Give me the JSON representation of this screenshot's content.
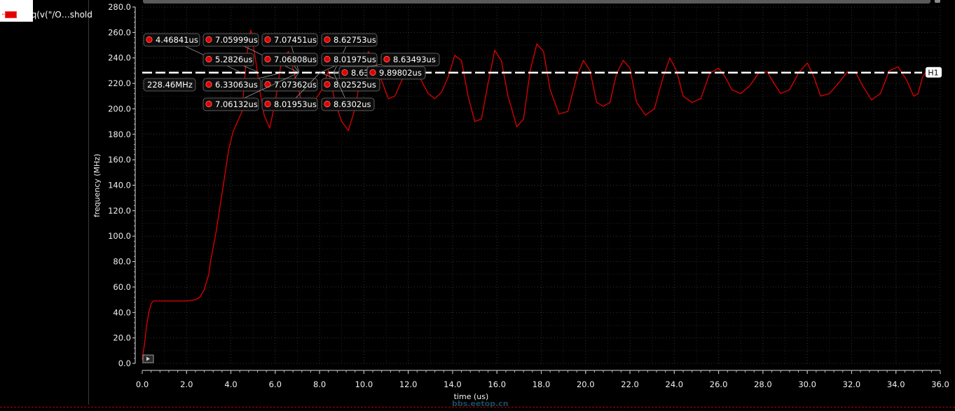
{
  "legend": {
    "label": "freq(v(\"/O…shold"
  },
  "watermark": "bbs.eetop.cn",
  "colors": {
    "trace": "#e00000",
    "background": "#000000",
    "grid": "#2e2e2e",
    "marker_line": "#ffffff"
  },
  "icons": {
    "play": "play-icon"
  },
  "chart_data": {
    "type": "line",
    "xlabel": "time (us)",
    "ylabel": "frequency (MHz)",
    "xlim": [
      0,
      36
    ],
    "ylim": [
      0,
      280
    ],
    "x_ticks": [
      "0.0",
      "2.0",
      "4.0",
      "6.0",
      "8.0",
      "10.0",
      "12.0",
      "14.0",
      "16.0",
      "18.0",
      "20.0",
      "22.0",
      "24.0",
      "26.0",
      "28.0",
      "30.0",
      "32.0",
      "34.0",
      "36.0"
    ],
    "y_ticks": [
      "0.0",
      "20.0",
      "40.0",
      "60.0",
      "80.0",
      "100.0",
      "120.0",
      "140.0",
      "160.0",
      "180.0",
      "200.0",
      "220.0",
      "240.0",
      "260.0",
      "280.0"
    ],
    "grid": true,
    "legend_position": "top-left",
    "series": [
      {
        "name": "freq(v(\"/O…shold",
        "points": [
          [
            0.0,
            3
          ],
          [
            0.1,
            15
          ],
          [
            0.2,
            30
          ],
          [
            0.3,
            40
          ],
          [
            0.4,
            47
          ],
          [
            0.5,
            49
          ],
          [
            0.8,
            49
          ],
          [
            1.5,
            49
          ],
          [
            2.0,
            49
          ],
          [
            2.4,
            50
          ],
          [
            2.6,
            52
          ],
          [
            2.8,
            58
          ],
          [
            3.0,
            70
          ],
          [
            3.1,
            82
          ],
          [
            3.3,
            100
          ],
          [
            3.5,
            122
          ],
          [
            3.7,
            145
          ],
          [
            3.9,
            168
          ],
          [
            4.1,
            182
          ],
          [
            4.3,
            190
          ],
          [
            4.5,
            198
          ],
          [
            4.7,
            240
          ],
          [
            4.9,
            262
          ],
          [
            5.1,
            240
          ],
          [
            5.3,
            215
          ],
          [
            5.5,
            195
          ],
          [
            5.75,
            185
          ],
          [
            6.0,
            205
          ],
          [
            6.3,
            240
          ],
          [
            6.6,
            245
          ],
          [
            6.9,
            225
          ],
          [
            7.2,
            205
          ],
          [
            7.5,
            200
          ],
          [
            7.8,
            207
          ],
          [
            8.1,
            215
          ],
          [
            8.4,
            230
          ],
          [
            8.7,
            205
          ],
          [
            9.0,
            190
          ],
          [
            9.3,
            183
          ],
          [
            9.6,
            200
          ],
          [
            9.9,
            230
          ],
          [
            10.2,
            245
          ],
          [
            10.5,
            238
          ],
          [
            10.8,
            222
          ],
          [
            11.1,
            208
          ],
          [
            11.4,
            210
          ],
          [
            11.7,
            222
          ],
          [
            12.0,
            232
          ],
          [
            12.3,
            230
          ],
          [
            12.6,
            222
          ],
          [
            12.9,
            212
          ],
          [
            13.2,
            208
          ],
          [
            13.5,
            213
          ],
          [
            13.8,
            225
          ],
          [
            14.1,
            242
          ],
          [
            14.4,
            238
          ],
          [
            14.7,
            210
          ],
          [
            15.0,
            190
          ],
          [
            15.3,
            192
          ],
          [
            15.6,
            220
          ],
          [
            15.9,
            246
          ],
          [
            16.2,
            238
          ],
          [
            16.5,
            210
          ],
          [
            16.9,
            186
          ],
          [
            17.2,
            192
          ],
          [
            17.5,
            230
          ],
          [
            17.8,
            251
          ],
          [
            18.1,
            245
          ],
          [
            18.4,
            215
          ],
          [
            18.8,
            196
          ],
          [
            19.2,
            198
          ],
          [
            19.6,
            225
          ],
          [
            19.9,
            238
          ],
          [
            20.2,
            230
          ],
          [
            20.5,
            205
          ],
          [
            20.8,
            202
          ],
          [
            21.1,
            205
          ],
          [
            21.4,
            228
          ],
          [
            21.7,
            238
          ],
          [
            22.0,
            232
          ],
          [
            22.3,
            205
          ],
          [
            22.7,
            195
          ],
          [
            23.1,
            200
          ],
          [
            23.5,
            225
          ],
          [
            23.8,
            240
          ],
          [
            24.1,
            230
          ],
          [
            24.4,
            210
          ],
          [
            24.8,
            205
          ],
          [
            25.2,
            208
          ],
          [
            25.6,
            228
          ],
          [
            26.0,
            232
          ],
          [
            26.3,
            225
          ],
          [
            26.6,
            215
          ],
          [
            27.0,
            212
          ],
          [
            27.4,
            218
          ],
          [
            27.8,
            228
          ],
          [
            28.2,
            229
          ],
          [
            28.5,
            220
          ],
          [
            28.8,
            212
          ],
          [
            29.2,
            215
          ],
          [
            29.6,
            228
          ],
          [
            30.0,
            236
          ],
          [
            30.3,
            225
          ],
          [
            30.6,
            210
          ],
          [
            31.0,
            212
          ],
          [
            31.4,
            220
          ],
          [
            31.8,
            229
          ],
          [
            32.2,
            228
          ],
          [
            32.5,
            218
          ],
          [
            32.9,
            207
          ],
          [
            33.3,
            212
          ],
          [
            33.7,
            230
          ],
          [
            34.1,
            233
          ],
          [
            34.5,
            222
          ],
          [
            34.8,
            210
          ],
          [
            35.0,
            212
          ],
          [
            35.2,
            225
          ],
          [
            35.4,
            230
          ]
        ]
      }
    ],
    "horizontal_marker": {
      "name": "H1",
      "value": 228.46,
      "label": "228.46MHz"
    },
    "crossing_markers": [
      {
        "label": "4.46841us",
        "x": 4.46841
      },
      {
        "label": "7.05999us",
        "x": 7.05999
      },
      {
        "label": "7.07451us",
        "x": 7.07451
      },
      {
        "label": "8.62753us",
        "x": 8.62753
      },
      {
        "label": "5.2826us",
        "x": 5.2826
      },
      {
        "label": "7.06808us",
        "x": 7.06808
      },
      {
        "label": "8.01975us",
        "x": 8.01975
      },
      {
        "label": "8.63493us",
        "x": 8.63493
      },
      {
        "label": "8.63",
        "x": 8.63
      },
      {
        "label": "9.89802us",
        "x": 9.89802
      },
      {
        "label": "6.33063us",
        "x": 6.33063
      },
      {
        "label": "7.07362us",
        "x": 7.07362
      },
      {
        "label": "8.02525us",
        "x": 8.02525
      },
      {
        "label": "7.06132us",
        "x": 7.06132
      },
      {
        "label": "8.01953us",
        "x": 8.01953
      },
      {
        "label": "8.6302us",
        "x": 8.6302
      }
    ]
  }
}
